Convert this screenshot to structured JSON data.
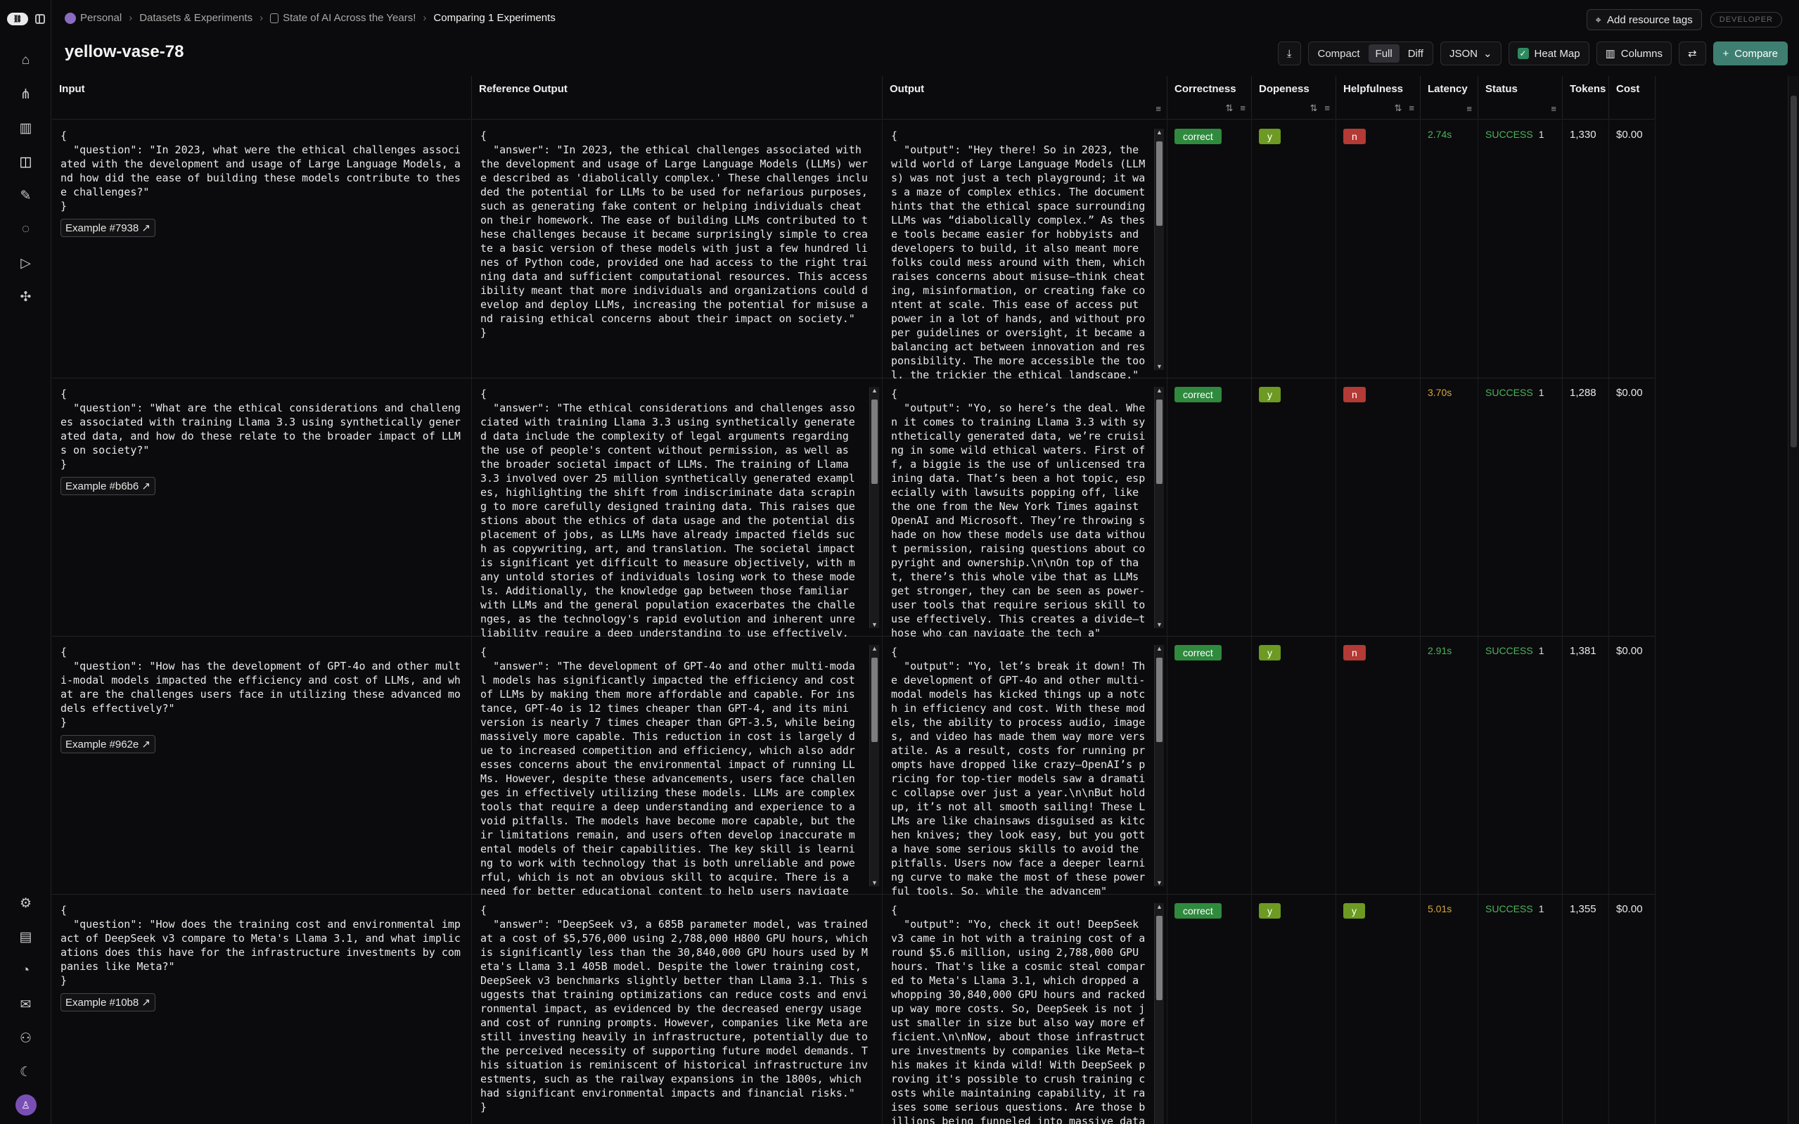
{
  "breadcrumbs": {
    "workspace": "Personal",
    "section": "Datasets & Experiments",
    "dataset": "State of AI Across the Years!",
    "current": "Comparing 1 Experiments"
  },
  "header": {
    "add_tags": "Add resource tags",
    "badge": "DEVELOPER",
    "title": "yellow-vase-78"
  },
  "toolbar": {
    "compact": "Compact",
    "full": "Full",
    "diff": "Diff",
    "format": "JSON",
    "heatmap": "Heat Map",
    "columns": "Columns",
    "compare": "Compare"
  },
  "columns": {
    "input": "Input",
    "reference": "Reference Output",
    "output": "Output",
    "correctness": "Correctness",
    "dopeness": "Dopeness",
    "helpfulness": "Helpfulness",
    "latency": "Latency",
    "status": "Status",
    "tokens": "Tokens",
    "cost": "Cost"
  },
  "rows": [
    {
      "input": "{\n  \"question\": \"In 2023, what were the ethical challenges associated with the development and usage of Large Language Models, and how did the ease of building these models contribute to these challenges?\"\n}",
      "example": "Example #7938 ↗",
      "reference": "{\n  \"answer\": \"In 2023, the ethical challenges associated with the development and usage of Large Language Models (LLMs) were described as 'diabolically complex.' These challenges included the potential for LLMs to be used for nefarious purposes, such as generating fake content or helping individuals cheat on their homework. The ease of building LLMs contributed to these challenges because it became surprisingly simple to create a basic version of these models with just a few hundred lines of Python code, provided one had access to the right training data and sufficient computational resources. This accessibility meant that more individuals and organizations could develop and deploy LLMs, increasing the potential for misuse and raising ethical concerns about their impact on society.\"\n}",
      "output": "{\n  \"output\": \"Hey there! So in 2023, the wild world of Large Language Models (LLMs) was not just a tech playground; it was a maze of complex ethics. The document hints that the ethical space surrounding LLMs was “diabolically complex.” As these tools became easier for hobbyists and developers to build, it also meant more folks could mess around with them, which raises concerns about misuse—think cheating, misinformation, or creating fake content at scale. This ease of access put power in a lot of hands, and without proper guidelines or oversight, it became a balancing act between innovation and responsibility. The more accessible the tool, the trickier the ethical landscape.\"\n}",
      "correctness": "correct",
      "dopeness": "y",
      "helpfulness": "n",
      "latency": "2.74s",
      "status": "SUCCESS",
      "status_count": "1",
      "tokens": "1,330",
      "cost": "$0.00"
    },
    {
      "input": "{\n  \"question\": \"What are the ethical considerations and challenges associated with training Llama 3.3 using synthetically generated data, and how do these relate to the broader impact of LLMs on society?\"\n}",
      "example": "Example #b6b6 ↗",
      "reference": "{\n  \"answer\": \"The ethical considerations and challenges associated with training Llama 3.3 using synthetically generated data include the complexity of legal arguments regarding the use of people's content without permission, as well as the broader societal impact of LLMs. The training of Llama 3.3 involved over 25 million synthetically generated examples, highlighting the shift from indiscriminate data scraping to more carefully designed training data. This raises questions about the ethics of data usage and the potential displacement of jobs, as LLMs have already impacted fields such as copywriting, art, and translation. The societal impact is significant yet difficult to measure objectively, with many untold stories of individuals losing work to these models. Additionally, the knowledge gap between those familiar with LLMs and the general population exacerbates the challenges, as the technology's rapid evolution and inherent unreliability require a deep understanding to use effectively. These factors underscore\"\n}",
      "output": "{\n  \"output\": \"Yo, so here’s the deal. When it comes to training Llama 3.3 with synthetically generated data, we’re cruising in some wild ethical waters. First off, a biggie is the use of unlicensed training data. That’s been a hot topic, especially with lawsuits popping off, like the one from the New York Times against OpenAI and Microsoft. They’re throwing shade on how these models use data without permission, raising questions about copyright and ownership.\\n\\nOn top of that, there’s this whole vibe that as LLMs get stronger, they can be seen as power-user tools that require serious skill to use effectively. This creates a divide—those who can navigate the tech a\"\n}",
      "correctness": "correct",
      "dopeness": "y",
      "helpfulness": "n",
      "latency": "3.70s",
      "status": "SUCCESS",
      "status_count": "1",
      "tokens": "1,288",
      "cost": "$0.00"
    },
    {
      "input": "{\n  \"question\": \"How has the development of GPT-4o and other multi-modal models impacted the efficiency and cost of LLMs, and what are the challenges users face in utilizing these advanced models effectively?\"\n}",
      "example": "Example #962e ↗",
      "reference": "{\n  \"answer\": \"The development of GPT-4o and other multi-modal models has significantly impacted the efficiency and cost of LLMs by making them more affordable and capable. For instance, GPT-4o is 12 times cheaper than GPT-4, and its mini version is nearly 7 times cheaper than GPT-3.5, while being massively more capable. This reduction in cost is largely due to increased competition and efficiency, which also addresses concerns about the environmental impact of running LLMs. However, despite these advancements, users face challenges in effectively utilizing these models. LLMs are complex tools that require a deep understanding and experience to avoid pitfalls. The models have become more capable, but their limitations remain, and users often develop inaccurate mental models of their capabilities. The key skill is learning to work with technology that is both unreliable and powerful, which is not an obvious skill to acquire. There is a need for better educational content to help users navigate these challenges.\"\n}",
      "output": "{\n  \"output\": \"Yo, let’s break it down! The development of GPT-4o and other multi-modal models has kicked things up a notch in efficiency and cost. With these models, the ability to process audio, images, and video has made them way more versatile. As a result, costs for running prompts have dropped like crazy—OpenAI’s pricing for top-tier models saw a dramatic collapse over just a year.\\n\\nBut hold up, it’s not all smooth sailing! These LLMs are like chainsaws disguised as kitchen knives; they look easy, but you gotta have some serious skills to avoid the pitfalls. Users now face a deeper learning curve to make the most of these powerful tools. So, while the advancem\"\n}",
      "correctness": "correct",
      "dopeness": "y",
      "helpfulness": "n",
      "latency": "2.91s",
      "status": "SUCCESS",
      "status_count": "1",
      "tokens": "1,381",
      "cost": "$0.00"
    },
    {
      "input": "{\n  \"question\": \"How does the training cost and environmental impact of DeepSeek v3 compare to Meta's Llama 3.1, and what implications does this have for the infrastructure investments by companies like Meta?\"\n}",
      "example": "Example #10b8 ↗",
      "reference": "{\n  \"answer\": \"DeepSeek v3, a 685B parameter model, was trained at a cost of $5,576,000 using 2,788,000 H800 GPU hours, which is significantly less than the 30,840,000 GPU hours used by Meta's Llama 3.1 405B model. Despite the lower training cost, DeepSeek v3 benchmarks slightly better than Llama 3.1. This suggests that training optimizations can reduce costs and environmental impact, as evidenced by the decreased energy usage and cost of running prompts. However, companies like Meta are still investing heavily in infrastructure, potentially due to the perceived necessity of supporting future model demands. This situation is reminiscent of historical infrastructure investments, such as the railway expansions in the 1800s, which had significant environmental impacts and financial risks.\"\n}",
      "output": "{\n  \"output\": \"Yo, check it out! DeepSeek v3 came in hot with a training cost of around $5.6 million, using 2,788,000 GPU hours. That's like a cosmic steal compared to Meta's Llama 3.1, which dropped a whopping 30,840,000 GPU hours and racked up way more costs. So, DeepSeek is not just smaller in size but also way more efficient.\\n\\nNow, about those infrastructure investments by companies like Meta—this makes it kinda wild! With DeepSeek proving it's possible to crush training costs while maintaining capability, it raises some serious questions. Are those billions being funneled into massive datacenter builds really necessary? I\"\n}",
      "correctness": "correct",
      "dopeness": "y",
      "helpfulness": "y",
      "latency": "5.01s",
      "status": "SUCCESS",
      "status_count": "1",
      "tokens": "1,355",
      "cost": "$0.00"
    }
  ],
  "colors": {
    "accent": "#3f7f72",
    "correct": "#2f8a3e",
    "yes": "#6c9a22",
    "no": "#b33a35",
    "success": "#4cb35a",
    "latency_warn": "#d7a63a"
  }
}
